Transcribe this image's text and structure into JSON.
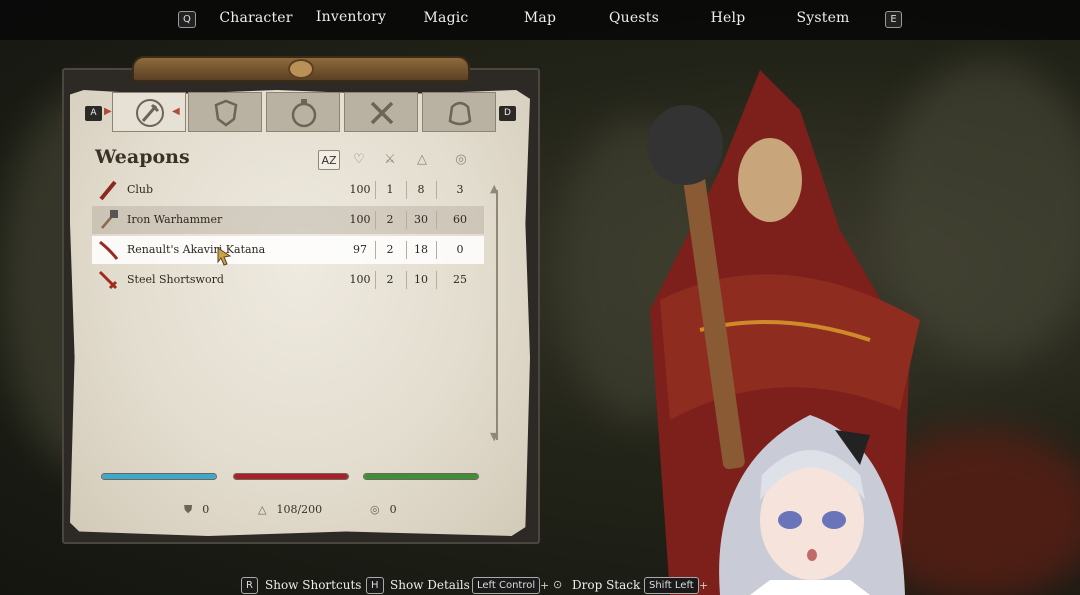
{
  "menu": {
    "left_key": "Q",
    "right_key": "E",
    "items": [
      "Character",
      "Inventory",
      "Magic",
      "Map",
      "Quests",
      "Help",
      "System"
    ],
    "active": "Inventory"
  },
  "inventory": {
    "tab_keys": {
      "prev": "A",
      "next": "D"
    },
    "tab_icons": [
      "weapons-icon",
      "armor-icon",
      "potions-icon",
      "tools-icon",
      "misc-icon"
    ],
    "section_title": "Weapons",
    "sort_icons": [
      "alphabetical-sort-icon",
      "favorite-icon",
      "damage-icon",
      "weight-icon",
      "value-icon"
    ],
    "sort_az_label": "AZ",
    "items": [
      {
        "name": "Club",
        "icon": "club-icon",
        "v1": "100",
        "v2": "1",
        "v3": "8",
        "v4": "3"
      },
      {
        "name": "Iron Warhammer",
        "icon": "warhammer-icon",
        "v1": "100",
        "v2": "2",
        "v3": "30",
        "v4": "60"
      },
      {
        "name": "Renault's Akaviri Katana",
        "icon": "katana-icon",
        "v1": "97",
        "v2": "2",
        "v3": "18",
        "v4": "0"
      },
      {
        "name": "Steel Shortsword",
        "icon": "shortsword-icon",
        "v1": "100",
        "v2": "2",
        "v3": "10",
        "v4": "25"
      }
    ],
    "bars": [
      {
        "name": "magicka",
        "color": "#3fa7c9",
        "fill": 1.0
      },
      {
        "name": "health",
        "color": "#a8202a",
        "fill": 1.0
      },
      {
        "name": "stamina",
        "color": "#3f8f3a",
        "fill": 1.0
      }
    ],
    "stats": {
      "armor": "0",
      "weight": "108/200",
      "gold": "0"
    }
  },
  "hints": [
    {
      "key": "R",
      "label": "Show Shortcuts"
    },
    {
      "key": "H",
      "label": "Show Details"
    },
    {
      "key": "Left Control",
      "label": "Drop Stack"
    },
    {
      "key": "Shift Left"
    }
  ]
}
